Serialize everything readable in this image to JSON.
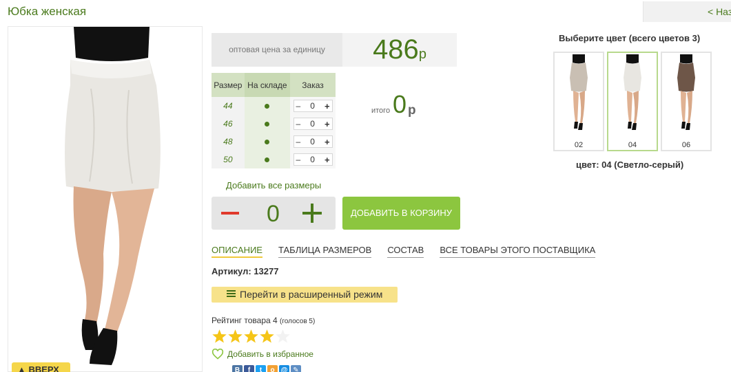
{
  "product": {
    "title": "Юбка женская",
    "back_label": "< Назад"
  },
  "price": {
    "label": "оптовая цена за единицу",
    "value": "486",
    "currency": "р"
  },
  "size_table": {
    "headers": [
      "Размер",
      "На складе",
      "Заказ"
    ],
    "rows": [
      {
        "size": "44",
        "qty": "0"
      },
      {
        "size": "46",
        "qty": "0"
      },
      {
        "size": "48",
        "qty": "0"
      },
      {
        "size": "50",
        "qty": "0"
      }
    ],
    "minus": "–",
    "plus": "+"
  },
  "total": {
    "label": "итого",
    "value": "0",
    "currency": "р"
  },
  "add_all_sizes": "Добавить все размеры",
  "quantity": "0",
  "add_to_cart": "ДОБАВИТЬ В КОРЗИНУ",
  "tabs": [
    "ОПИСАНИЕ",
    "ТАБЛИЦА РАЗМЕРОВ",
    "СОСТАВ",
    "ВСЕ ТОВАРЫ ЭТОГО ПОСТАВЩИКА"
  ],
  "article": "Артикул: 13277",
  "extended_mode": "Перейти в расширенный режим",
  "rating": {
    "text": "Рейтинг товара 4",
    "votes": "(голосов 5)",
    "value": 4,
    "max": 5
  },
  "favorites": "Добавить в избранное",
  "up_button": "▲ ВВЕРХ",
  "colors": {
    "title": "Выберите цвет (всего цветов 3)",
    "items": [
      {
        "label": "02",
        "color": "#c9bfb3"
      },
      {
        "label": "04",
        "color": "#e8e6e1"
      },
      {
        "label": "06",
        "color": "#6e5648"
      }
    ],
    "selected": "цвет: 04 (Светло-серый)"
  },
  "social": [
    {
      "name": "vk",
      "color": "#4c75a3",
      "glyph": "В"
    },
    {
      "name": "facebook",
      "color": "#3b5998",
      "glyph": "f"
    },
    {
      "name": "twitter",
      "color": "#1da1f2",
      "glyph": "t"
    },
    {
      "name": "odnoklassniki",
      "color": "#f2a134",
      "glyph": "о"
    },
    {
      "name": "mail",
      "color": "#168de2",
      "glyph": "@"
    },
    {
      "name": "livejournal",
      "color": "#5e8ec4",
      "glyph": "✎"
    }
  ],
  "theme": {
    "accent_green": "#4a7a1c",
    "button_green": "#8cc63f",
    "minus_red": "#e0392b",
    "star_yellow": "#f5c518"
  }
}
